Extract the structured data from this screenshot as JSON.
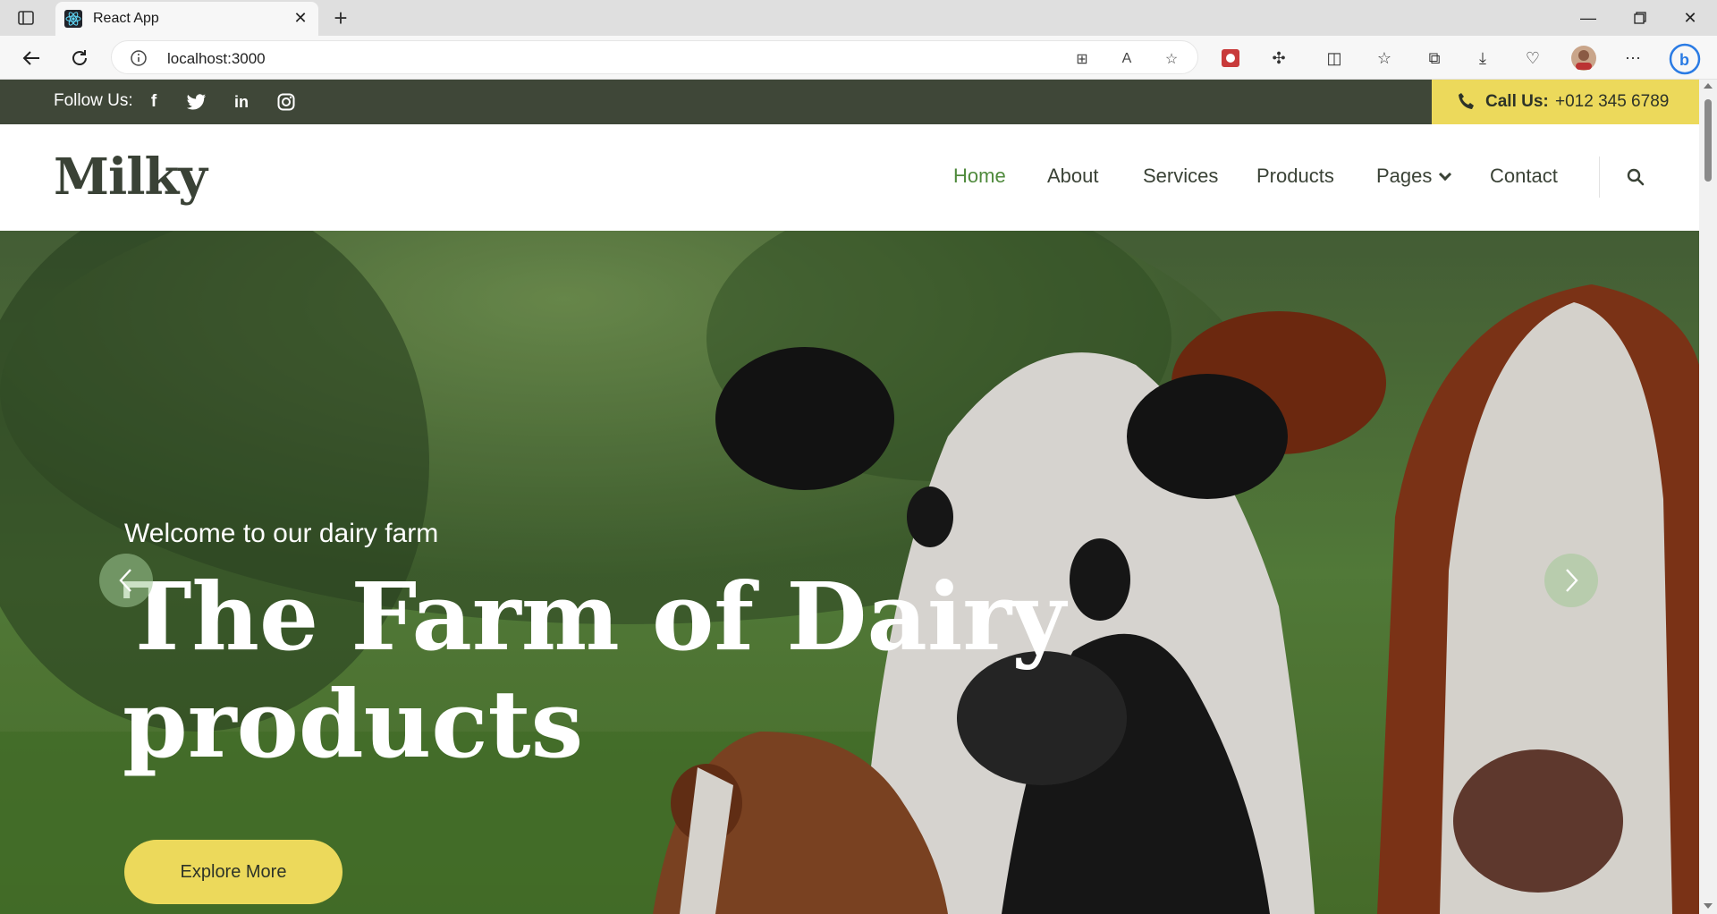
{
  "browser": {
    "tab_title": "React App",
    "url": "localhost:3000",
    "icons": [
      "sidebar-icon",
      "react-favicon",
      "close-icon",
      "plus-icon",
      "minimize-icon",
      "restore-icon",
      "window-close-icon",
      "back-icon",
      "refresh-icon",
      "info-icon",
      "app-icon",
      "read-aloud-icon",
      "favorite-star-icon",
      "extension-icon",
      "puzzle-icon",
      "split-screen-icon",
      "favorites-icon",
      "collections-icon",
      "downloads-icon",
      "browser-essentials-icon",
      "profile-avatar",
      "more-icon",
      "bing-copilot-icon"
    ]
  },
  "topbar": {
    "follow_label": "Follow Us:",
    "social": [
      "facebook-icon",
      "twitter-icon",
      "linkedin-icon",
      "instagram-icon"
    ],
    "call_label": "Call Us:",
    "call_number": "+012 345 6789",
    "bg_color": "#3f4738",
    "accent_color": "#ecd95b"
  },
  "nav": {
    "logo": "Milky",
    "items": [
      {
        "label": "Home",
        "active": true
      },
      {
        "label": "About"
      },
      {
        "label": "Services"
      },
      {
        "label": "Products"
      },
      {
        "label": "Pages"
      },
      {
        "label": "Contact"
      }
    ],
    "active_color": "#4f8a3c"
  },
  "hero": {
    "subtitle": "Welcome to our dairy farm",
    "title_line1": "The Farm of Dairy",
    "title_line2": "products",
    "button": "Explore More"
  }
}
